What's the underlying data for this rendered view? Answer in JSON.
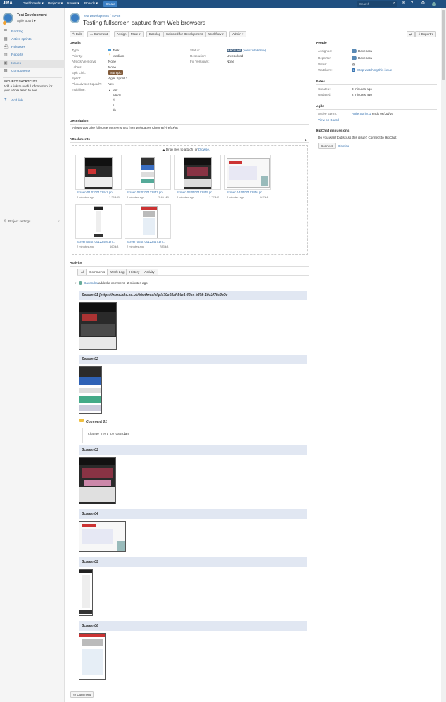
{
  "topnav": {
    "logo": "JIRA",
    "menus": [
      "Dashboards ▾",
      "Projects ▾",
      "Issues ▾",
      "Boards ▾"
    ],
    "create": "Create",
    "search_placeholder": "Search"
  },
  "sidebar": {
    "project_name": "Test Development",
    "board": "Agile Board ▾",
    "items": [
      "Backlog",
      "Active sprints",
      "Releases",
      "Reports",
      "Issues",
      "Components"
    ],
    "shortcuts_title": "PROJECT SHORTCUTS",
    "shortcuts_text": "Add a link to useful information for your whole team to see.",
    "add_link": "Add link",
    "settings": "Project settings"
  },
  "issue": {
    "breadcrumb": "Test Development / TD-36",
    "title": "Testing fullscreen capture from Web browsers"
  },
  "toolbar": {
    "edit": "Edit",
    "comment": "Comment",
    "assign": "Assign",
    "more": "More ▾",
    "backlog": "Backlog",
    "selected": "Selected for Development",
    "workflow": "Workflow ▾",
    "admin": "Admin ▾",
    "export": "Export ▾"
  },
  "details": {
    "title": "Details",
    "rows": [
      {
        "label": "Type:",
        "value": "Task"
      },
      {
        "label": "Priority:",
        "value": "Medium"
      },
      {
        "label": "Affects Version/s:",
        "value": "None"
      },
      {
        "label": "Labels:",
        "value": "None"
      },
      {
        "label": "Epic Link:",
        "value": "new epic"
      },
      {
        "label": "Sprint:",
        "value": "Agile Sprint 1"
      },
      {
        "label": "PlusAdvisor Squad?:",
        "value": "Yes"
      },
      {
        "label": "multi-line:",
        "value": "test"
      }
    ],
    "multiline_extra": [
      "sdsds",
      "d",
      "s",
      "ds"
    ],
    "right_rows": [
      {
        "label": "Status:",
        "value": "BACKLOG",
        "extra": "(View Workflow)"
      },
      {
        "label": "Resolution:",
        "value": "Unresolved"
      },
      {
        "label": "Fix Version/s:",
        "value": "None"
      }
    ]
  },
  "description": {
    "title": "Description",
    "text": "Allows you take fullscreen screenshots from webpages Chrome/Firefox/IE"
  },
  "attachments": {
    "title": "Attachments",
    "drop": "Drop files to attach, or",
    "browse": "browse.",
    "files": [
      {
        "name": "Screen 01 0700122442.pn...",
        "age": "2 minutes ago",
        "size": "1.26 MB"
      },
      {
        "name": "Screen 02 0700122443.pn...",
        "age": "2 minutes ago",
        "size": "2.49 MB"
      },
      {
        "name": "Screen 03 0700122445.pn...",
        "age": "2 minutes ago",
        "size": "1.77 MB"
      },
      {
        "name": "Screen 04 0700122446.pn...",
        "age": "2 minutes ago",
        "size": "167 kB"
      },
      {
        "name": "Screen 05 0700122446.pn...",
        "age": "2 minutes ago",
        "size": "660 kB"
      },
      {
        "name": "Screen 06 0700122447.pn...",
        "age": "2 minutes ago",
        "size": "783 kB"
      }
    ]
  },
  "activity": {
    "title": "Activity",
    "tabs": [
      "All",
      "Comments",
      "Work Log",
      "History",
      "Activity"
    ],
    "author": "Davendra",
    "action": "added a comment - 2 minutes ago",
    "screen01": "Screen 01 [https://www.bbc.co.uk/bbcthree/clip/a70e93af-54c1-42ec-b40b-10a1f79a0c0e",
    "screen02": "Screen 02",
    "comment01": "Comment 01",
    "code": "Change Test to Caspian",
    "screen03": "Screen 03",
    "screen04": "Screen 04",
    "screen05": "Screen 05",
    "screen06": "Screen 06",
    "comment_button": "Comment"
  },
  "people": {
    "title": "People",
    "assignee_label": "Assignee:",
    "assignee": "Davendra",
    "reporter_label": "Reporter:",
    "reporter": "Davendra",
    "votes_label": "Votes:",
    "votes": "0",
    "watchers_label": "Watchers:",
    "watchers": "1",
    "stop": "Stop watching this issue"
  },
  "dates": {
    "title": "Dates",
    "created_label": "Created:",
    "created": "3 minutes ago",
    "updated_label": "Updated:",
    "updated": "2 minutes ago"
  },
  "agile": {
    "title": "Agile",
    "sprint_label": "Active Sprint:",
    "sprint": "Agile Sprint 1",
    "ends": "ends 06/Jul/16",
    "view": "View on Board"
  },
  "hipchat": {
    "title": "HipChat discussions",
    "text": "Do you want to discuss this issue? Connect to HipChat.",
    "connect": "Connect",
    "dismiss": "Dismiss"
  },
  "colors": {
    "nav": "#205081",
    "link": "#3572b0",
    "backlog": "#4a6785",
    "epic": "#815b3a"
  }
}
